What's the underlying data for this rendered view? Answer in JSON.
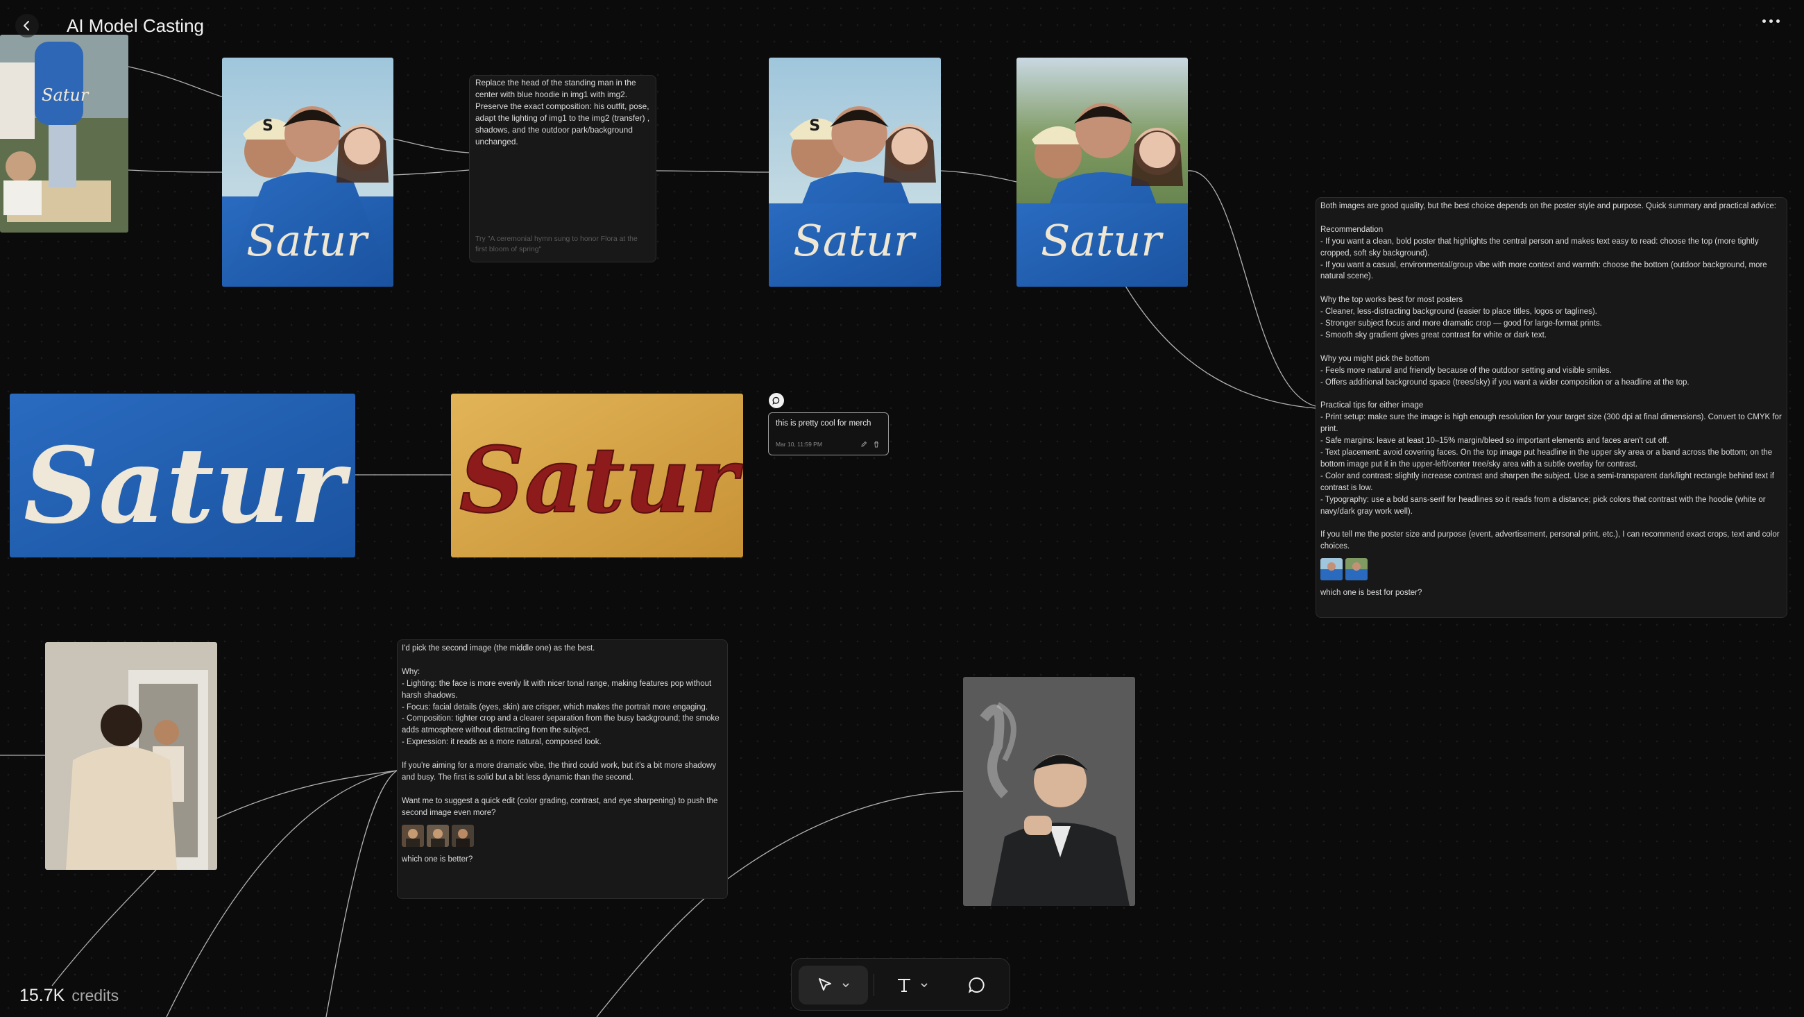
{
  "header": {
    "title": "AI Model Casting"
  },
  "credits": {
    "value": "15.7K",
    "label": "credits"
  },
  "prompt_node": {
    "text": "Replace the head of the standing man in the center with blue hoodie in img1 with img2. Preserve the exact composition: his outfit, pose, adapt the lighting of img1 to the img2 (transfer) , shadows, and the outdoor park/background unchanged.",
    "placeholder": "Try \"A ceremonial hymn sung to honor Flora at the first bloom of spring\""
  },
  "comment": {
    "text": "this is pretty cool for merch",
    "timestamp": "Mar 10, 11:59 PM"
  },
  "chat_right": {
    "lines": [
      "Both images are good quality, but the best choice depends on the poster style and purpose. Quick summary and practical advice:",
      "",
      "Recommendation",
      "- If you want a clean, bold poster that highlights the central person and makes text easy to read: choose the top (more tightly cropped, soft sky background).",
      "- If you want a casual, environmental/group vibe with more context and warmth: choose the bottom (outdoor background, more natural scene).",
      "",
      "Why the top works best for most posters",
      "- Cleaner, less-distracting background (easier to place titles, logos or taglines).",
      "- Stronger subject focus and more dramatic crop — good for large-format prints.",
      "- Smooth sky gradient gives great contrast for white or dark text.",
      "",
      "Why you might pick the bottom",
      "- Feels more natural and friendly because of the outdoor setting and visible smiles.",
      "- Offers additional background space (trees/sky) if you want a wider composition or a headline at the top.",
      "",
      "Practical tips for either image",
      "- Print setup: make sure the image is high enough resolution for your target size (300 dpi at final dimensions). Convert to CMYK for print.",
      "- Safe margins: leave at least 10–15% margin/bleed so important elements and faces aren't cut off.",
      "- Text placement: avoid covering faces. On the top image put headline in the upper sky area or a band across the bottom; on the bottom image put it in the upper-left/center tree/sky area with a subtle overlay for contrast.",
      "- Color and contrast: slightly increase contrast and sharpen the subject. Use a semi-transparent dark/light rectangle behind text if contrast is low.",
      "- Typography: use a bold sans-serif for headlines so it reads from a distance; pick colors that contrast with the hoodie (white or navy/dark gray work well).",
      "",
      "If you tell me the poster size and purpose (event, advertisement, personal print, etc.), I can recommend exact crops, text and color choices."
    ],
    "question": "which one is best for poster?"
  },
  "chat_bottom": {
    "lines": [
      "I'd pick the second image (the middle one) as the best.",
      "",
      "Why:",
      "- Lighting: the face is more evenly lit with nicer tonal range, making features pop without harsh shadows.",
      "- Focus: facial details (eyes, skin) are crisper, which makes the portrait more engaging.",
      "- Composition: tighter crop and a clearer separation from the busy background; the smoke adds atmosphere without distracting from the subject.",
      "- Expression: it reads as a more natural, composed look.",
      "",
      "If you're aiming for a more dramatic vibe, the third could work, but it's a bit more shadowy and busy. The first is solid but a bit less dynamic than the second.",
      "",
      "Want me to suggest a quick edit (color grading, contrast, and eye sharpening) to push the second image even more?"
    ],
    "question": "which one is better?"
  },
  "images": {
    "hoodie_text": "Satur",
    "cap_letter": "S"
  },
  "icons": {
    "back": "chevron-left-icon",
    "more": "more-horizontal-icon",
    "select": "pointer-icon",
    "text": "text-tool-icon",
    "comment": "speech-bubble-icon",
    "edit": "edit-icon",
    "delete": "trash-icon"
  },
  "colors": {
    "background": "#0b0b0b",
    "card": "#181818",
    "hoodie_blue": "#1f5fb0",
    "patch_red": "#8e1b1b",
    "patch_yellow": "#d9a949"
  }
}
